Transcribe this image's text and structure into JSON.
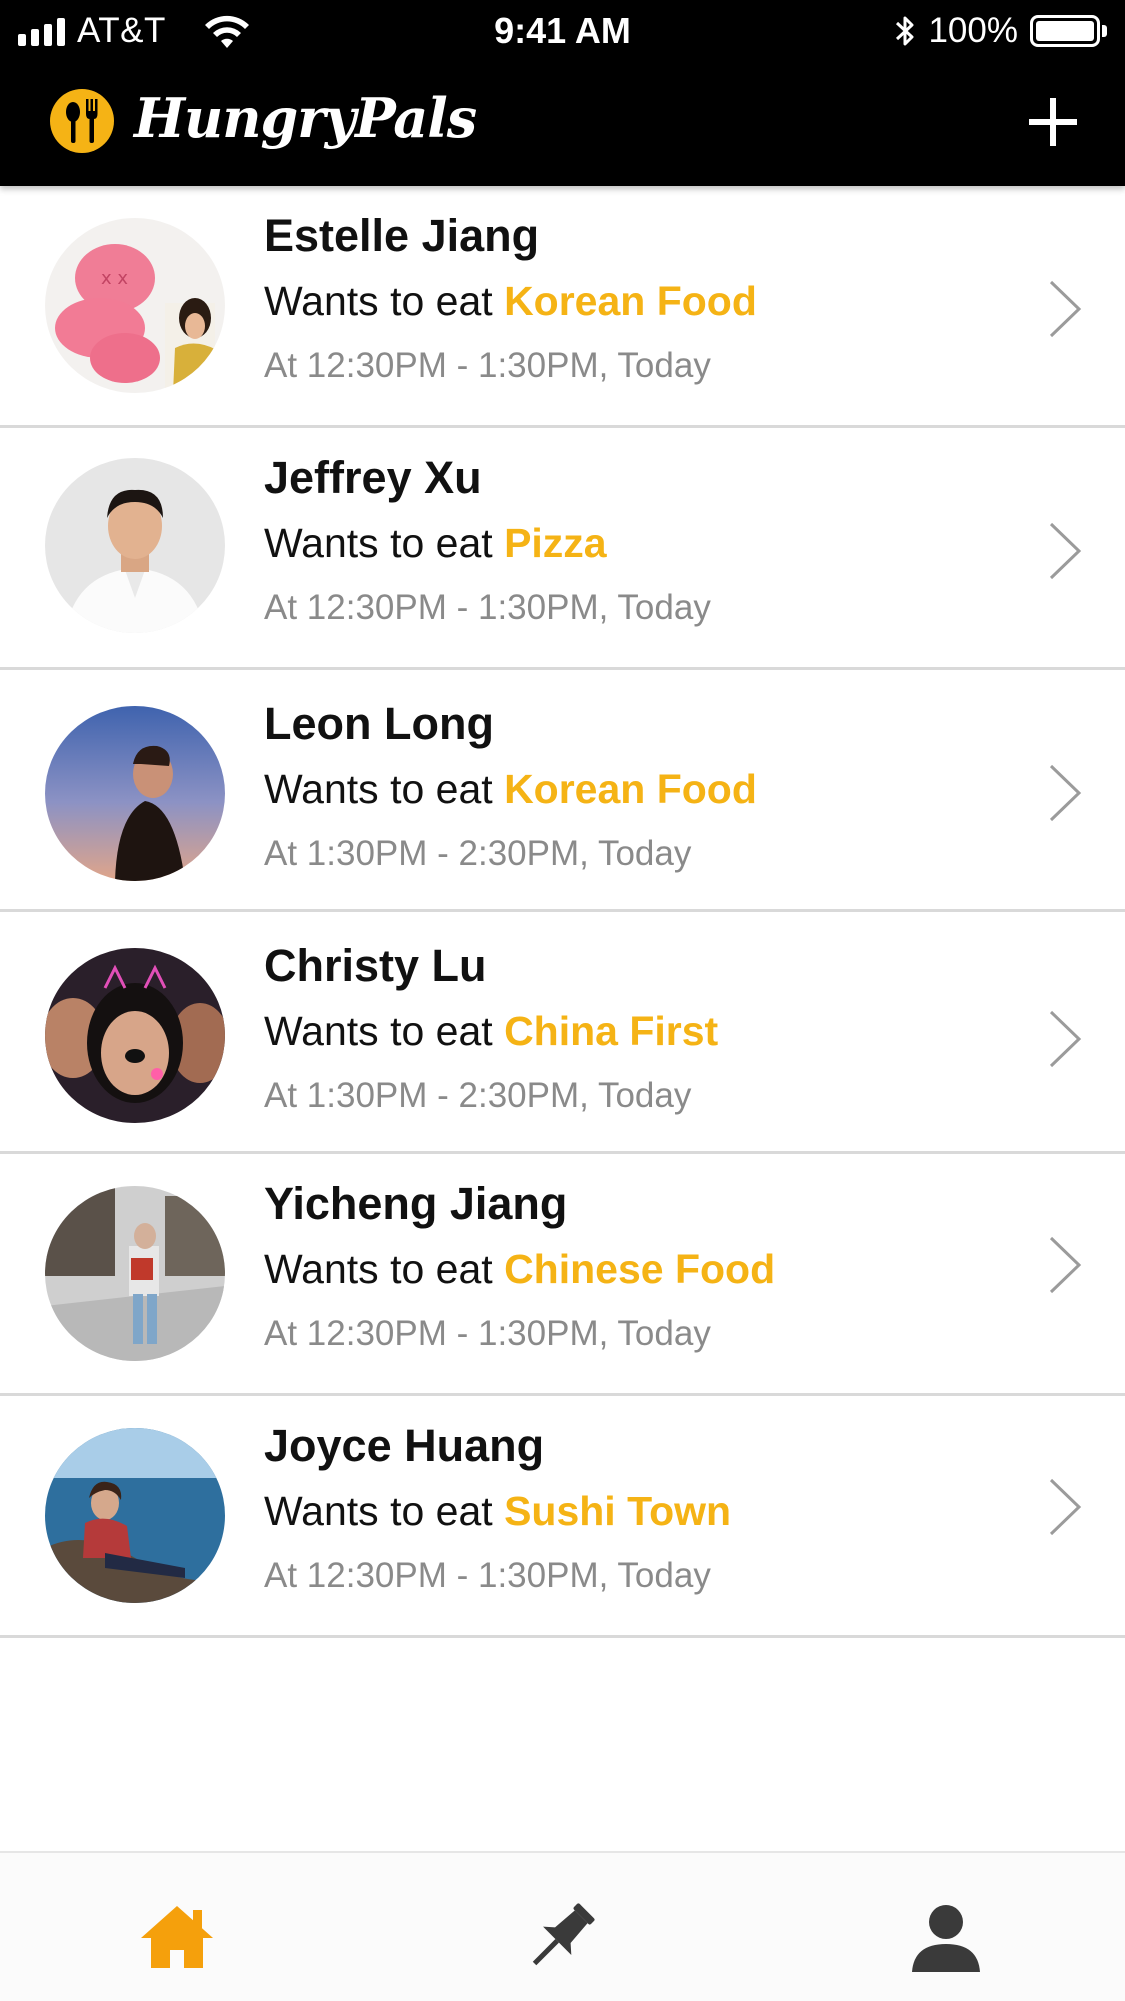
{
  "status_bar": {
    "carrier": "AT&T",
    "time": "9:41 AM",
    "battery": "100%"
  },
  "header": {
    "title": "HungryPals",
    "add_icon": "plus-icon",
    "logo_icon": "fork-spoon-logo-icon"
  },
  "colors": {
    "accent": "#f5b315",
    "header_bg": "#000000",
    "tab_inactive": "#3a3a3a"
  },
  "requests": [
    {
      "name": "Estelle Jiang",
      "wants_prefix": "Wants to eat",
      "food": "Korean Food",
      "time": "At 12:30PM - 1:30PM,",
      "day": "Today"
    },
    {
      "name": "Jeffrey Xu",
      "wants_prefix": "Wants to eat",
      "food": "Pizza",
      "time": "At 12:30PM - 1:30PM,",
      "day": "Today"
    },
    {
      "name": "Leon Long",
      "wants_prefix": "Wants to eat",
      "food": "Korean Food",
      "time": "At 1:30PM - 2:30PM,",
      "day": "Today"
    },
    {
      "name": "Christy Lu",
      "wants_prefix": "Wants to eat",
      "food": "China First",
      "time": "At 1:30PM - 2:30PM,",
      "day": "Today"
    },
    {
      "name": "Yicheng Jiang",
      "wants_prefix": "Wants to eat",
      "food": "Chinese Food",
      "time": "At 12:30PM - 1:30PM,",
      "day": "Today"
    },
    {
      "name": "Joyce Huang",
      "wants_prefix": "Wants to eat",
      "food": "Sushi Town",
      "time": "At 12:30PM - 1:30PM,",
      "day": "Today"
    }
  ],
  "tabs": [
    {
      "icon": "home-icon",
      "active": true
    },
    {
      "icon": "pin-icon",
      "active": false
    },
    {
      "icon": "profile-icon",
      "active": false
    }
  ]
}
